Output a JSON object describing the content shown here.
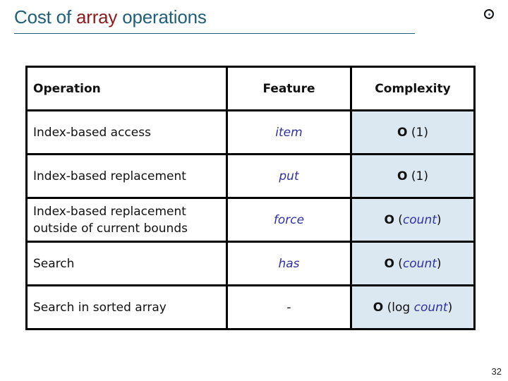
{
  "slide": {
    "title_prefix": "Cost of ",
    "title_accent": "array",
    "title_suffix": " operations",
    "logo_icon": "circled-dot-icon",
    "page_number": "32"
  },
  "table": {
    "headers": {
      "operation": "Operation",
      "feature": "Feature",
      "complexity": "Complexity"
    },
    "rows": [
      {
        "operation": "Index-based access",
        "feature": "item",
        "complexity": {
          "big_o": "O",
          "open": " (",
          "plain": "1",
          "arg": "",
          "close": ")"
        }
      },
      {
        "operation": "Index-based replacement",
        "feature": "put",
        "complexity": {
          "big_o": "O",
          "open": " (",
          "plain": "1",
          "arg": "",
          "close": ")"
        }
      },
      {
        "operation": "Index-based replacement outside of current bounds",
        "feature": "force",
        "complexity": {
          "big_o": "O",
          "open": " (",
          "plain": "",
          "arg": "count",
          "close": ")"
        }
      },
      {
        "operation": "Search",
        "feature": "has",
        "complexity": {
          "big_o": "O",
          "open": " (",
          "plain": "",
          "arg": "count",
          "close": ")"
        }
      },
      {
        "operation": "Search in sorted array",
        "feature": "-",
        "complexity": {
          "big_o": "O",
          "open": " (",
          "plain": "log ",
          "arg": "count",
          "close": ")"
        }
      }
    ]
  },
  "colors": {
    "title": "#1f5f7a",
    "title_accent": "#8b1a1a",
    "feature_text": "#2f2fa8",
    "complexity_cell_bg": "#dce8f1"
  }
}
